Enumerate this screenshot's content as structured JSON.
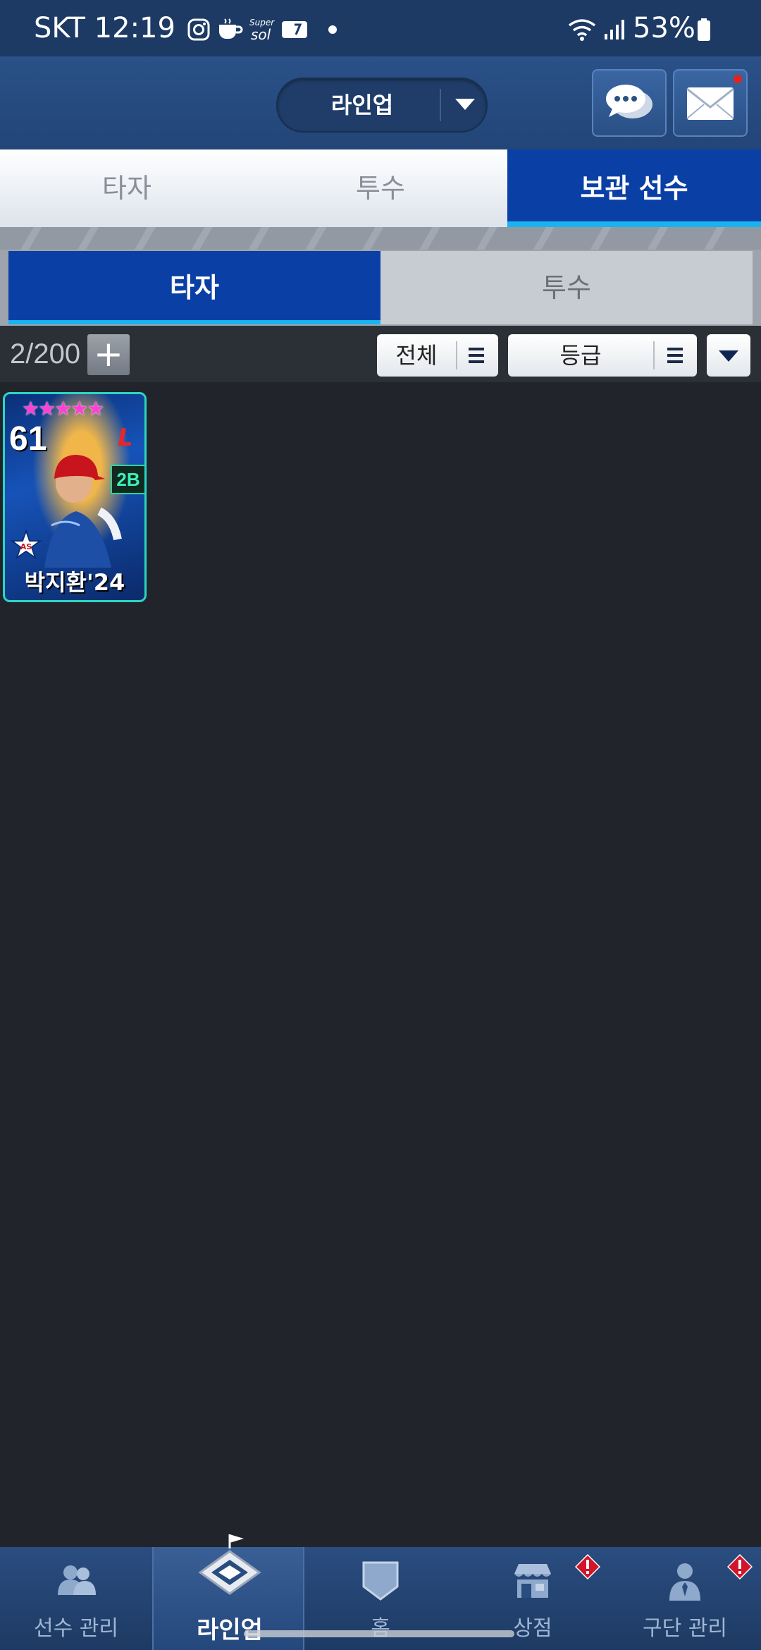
{
  "status_bar": {
    "carrier_time": "SKT 12:19",
    "battery": "53%"
  },
  "header": {
    "lineup_select": "라인업"
  },
  "main_tabs": [
    "타자",
    "투수",
    "보관 선수"
  ],
  "sub_tabs": [
    "타자",
    "투수"
  ],
  "filter_bar": {
    "count": "2/200",
    "add_label": "+",
    "filter_all": "전체",
    "filter_grade": "등급"
  },
  "card": {
    "ovr": "61",
    "team": "L",
    "position": "2B",
    "name": "박지환'24",
    "stars": "★★★★★"
  },
  "bottom_nav": {
    "items": [
      {
        "label": "선수 관리",
        "icon": "players-icon"
      },
      {
        "label": "라인업",
        "icon": "stadium-icon"
      },
      {
        "label": "홈",
        "icon": "home-plate-icon"
      },
      {
        "label": "상점",
        "icon": "shop-icon"
      },
      {
        "label": "구단 관리",
        "icon": "manager-icon"
      }
    ]
  },
  "colors": {
    "accent": "#0a3fa6",
    "highlight": "#19b3f0",
    "alert": "#d2152a"
  }
}
